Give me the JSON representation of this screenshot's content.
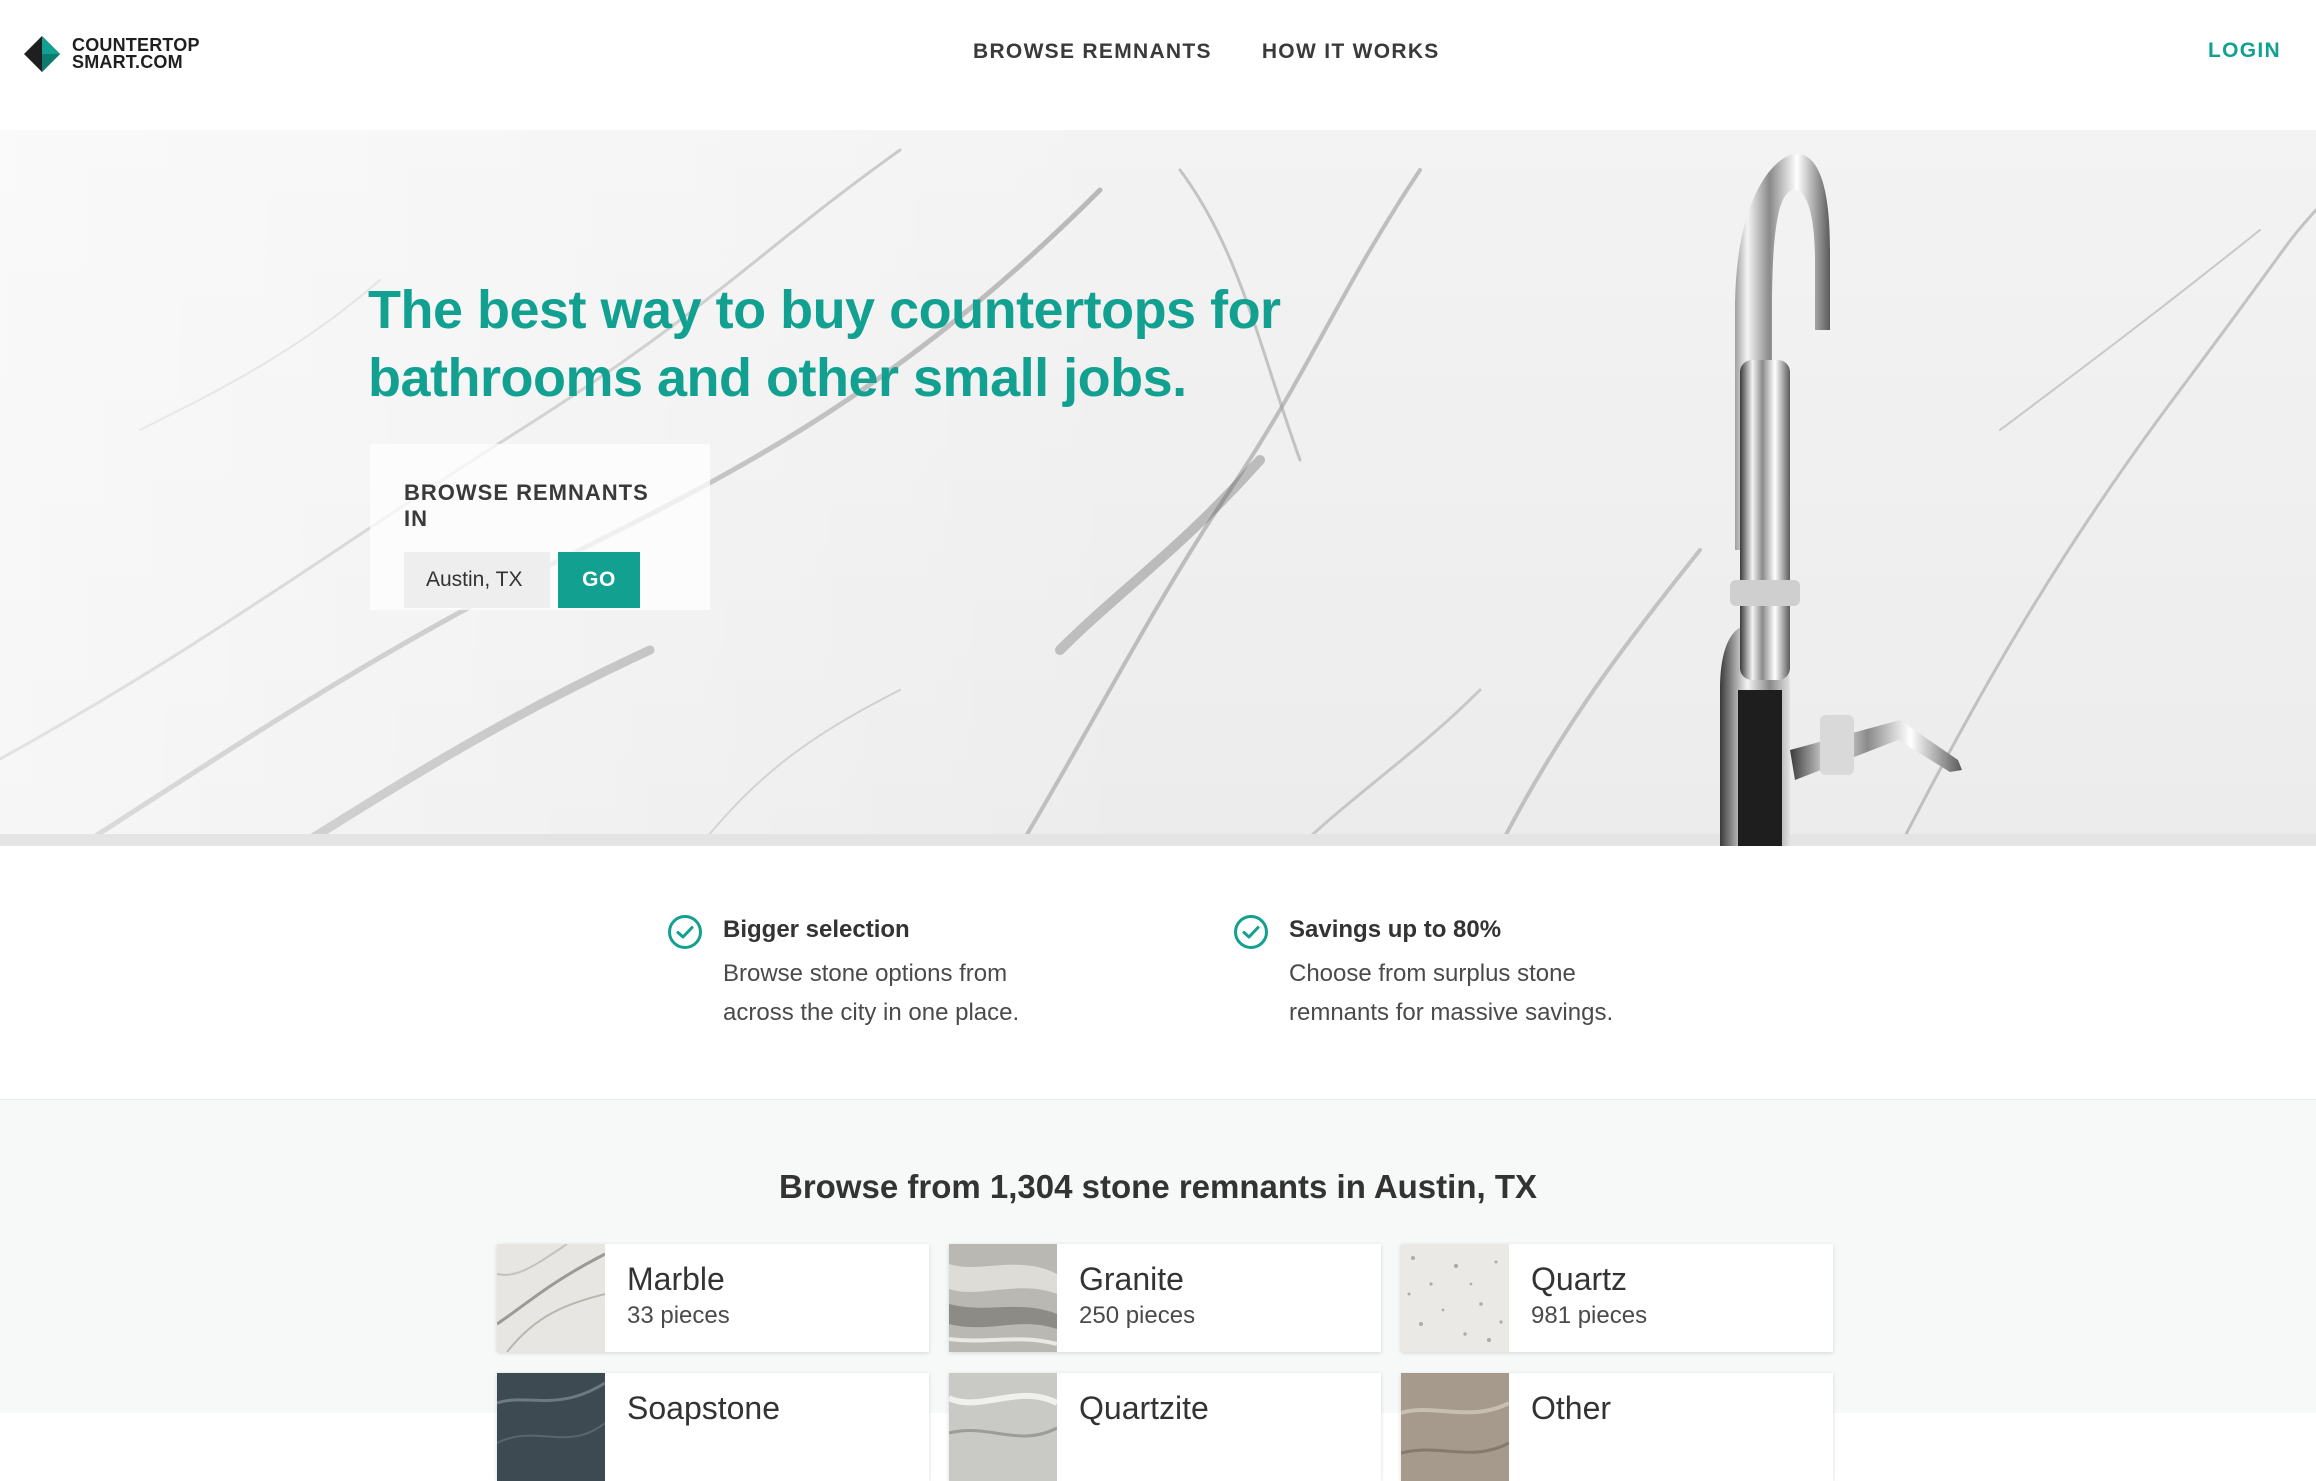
{
  "header": {
    "logo_line1": "COUNTERTOP",
    "logo_line2": "SMART.COM",
    "nav": [
      "BROWSE REMNANTS",
      "HOW IT WORKS"
    ],
    "login": "LOGIN",
    "accent_color": "#12a091"
  },
  "hero": {
    "headline": "The best way to buy countertops for bathrooms and other small jobs.",
    "browse_label": "BROWSE REMNANTS IN",
    "location_value": "Austin, TX",
    "go_label": "GO"
  },
  "features": [
    {
      "icon": "check-circle-icon",
      "title": "Bigger selection",
      "desc": "Browse stone options from across the city in one place."
    },
    {
      "icon": "check-circle-icon",
      "title": "Savings up to 80%",
      "desc": "Choose from surplus stone remnants for massive savings."
    }
  ],
  "categories": {
    "heading_prefix": "Browse from",
    "count": "1,304",
    "heading_suffix": "stone remnants in Austin, TX",
    "items": [
      {
        "name": "Marble",
        "count": "33 pieces"
      },
      {
        "name": "Granite",
        "count": "250 pieces"
      },
      {
        "name": "Quartz",
        "count": "981 pieces"
      },
      {
        "name": "Soapstone",
        "count": ""
      },
      {
        "name": "Quartzite",
        "count": ""
      },
      {
        "name": "Other",
        "count": ""
      }
    ]
  }
}
